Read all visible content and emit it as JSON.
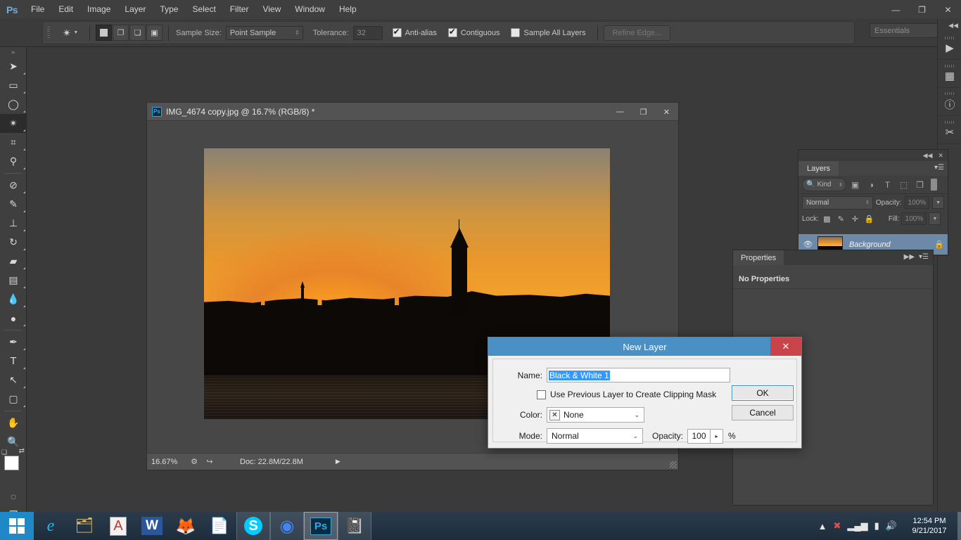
{
  "app": {
    "name": "Adobe Photoshop",
    "logo": "Ps",
    "menus": [
      "File",
      "Edit",
      "Image",
      "Layer",
      "Type",
      "Select",
      "Filter",
      "View",
      "Window",
      "Help"
    ],
    "window_buttons": {
      "minimize": "—",
      "restore": "❐",
      "close": "✕"
    }
  },
  "options_bar": {
    "tool_icon": "magic-wand",
    "sample_size_label": "Sample Size:",
    "sample_size_value": "Point Sample",
    "tolerance_label": "Tolerance:",
    "tolerance_value": "32",
    "antialias_label": "Anti-alias",
    "antialias_checked": true,
    "contiguous_label": "Contiguous",
    "contiguous_checked": true,
    "sample_all_layers_label": "Sample All Layers",
    "sample_all_layers_checked": false,
    "refine_edge_label": "Refine Edge...",
    "workspace_value": "Essentials"
  },
  "toolbar": {
    "tools": [
      {
        "name": "move-tool",
        "glyph": "➤",
        "active": false
      },
      {
        "name": "marquee-tool",
        "glyph": "▭",
        "active": false
      },
      {
        "name": "lasso-tool",
        "glyph": "◯",
        "active": false
      },
      {
        "name": "magic-wand-tool",
        "glyph": "✴",
        "active": true
      },
      {
        "name": "crop-tool",
        "glyph": "⌗",
        "active": false
      },
      {
        "name": "eyedropper-tool",
        "glyph": "⚲",
        "active": false
      },
      {
        "name": "healing-brush-tool",
        "glyph": "⊘",
        "active": false
      },
      {
        "name": "brush-tool",
        "glyph": "✎",
        "active": false
      },
      {
        "name": "clone-stamp-tool",
        "glyph": "⊥",
        "active": false
      },
      {
        "name": "history-brush-tool",
        "glyph": "↻",
        "active": false
      },
      {
        "name": "eraser-tool",
        "glyph": "▰",
        "active": false
      },
      {
        "name": "gradient-tool",
        "glyph": "▤",
        "active": false
      },
      {
        "name": "blur-tool",
        "glyph": "💧",
        "active": false
      },
      {
        "name": "dodge-tool",
        "glyph": "●",
        "active": false
      },
      {
        "name": "pen-tool",
        "glyph": "✒",
        "active": false
      },
      {
        "name": "type-tool",
        "glyph": "T",
        "active": false
      },
      {
        "name": "path-selection-tool",
        "glyph": "↖",
        "active": false
      },
      {
        "name": "rectangle-shape-tool",
        "glyph": "▢",
        "active": false
      },
      {
        "name": "hand-tool",
        "glyph": "✋",
        "active": false
      },
      {
        "name": "zoom-tool",
        "glyph": "🔍",
        "active": false
      }
    ],
    "foreground_color": "#ffffff",
    "background_color": "#ffffff",
    "quick_mask_glyph": "◌",
    "screen_mode_glyph": "❐"
  },
  "right_dock": {
    "collapse_glyph": "◀◀",
    "buttons": [
      {
        "name": "actions-panel-icon",
        "glyph": "▶"
      },
      {
        "name": "histogram-panel-icon",
        "glyph": "▦"
      },
      {
        "name": "info-panel-icon",
        "glyph": "ⓘ"
      },
      {
        "name": "tool-presets-panel-icon",
        "glyph": "✂"
      }
    ]
  },
  "document": {
    "title": "IMG_4674 copy.jpg @ 16.7% (RGB/8) *",
    "badge": "Ps",
    "window_buttons": {
      "minimize": "—",
      "restore": "❐",
      "close": "✕"
    },
    "status": {
      "zoom": "16.67%",
      "doc_label": "Doc: 22.8M/22.8M",
      "arrow": "▶"
    },
    "image_description": "Istanbul sunset skyline silhouette with Galata Tower"
  },
  "layers_panel": {
    "tab_label": "Layers",
    "collapse_glyph": "◀◀",
    "close_glyph": "✕",
    "menu_glyph": "▾☰",
    "filter": {
      "search_glyph": "🔍",
      "kind_value": "Kind",
      "icons": [
        {
          "name": "filter-pixel-layers-icon",
          "glyph": "▣"
        },
        {
          "name": "filter-adjustment-layers-icon",
          "glyph": "◑"
        },
        {
          "name": "filter-type-layers-icon",
          "glyph": "T"
        },
        {
          "name": "filter-shape-layers-icon",
          "glyph": "⬚"
        },
        {
          "name": "filter-smart-objects-icon",
          "glyph": "❐"
        }
      ]
    },
    "blend_mode": "Normal",
    "opacity_label": "Opacity:",
    "opacity_value": "100%",
    "lock_label": "Lock:",
    "lock_icons": [
      {
        "name": "lock-transparent-pixels-icon",
        "glyph": "▩"
      },
      {
        "name": "lock-image-pixels-icon",
        "glyph": "✎"
      },
      {
        "name": "lock-position-icon",
        "glyph": "✛"
      },
      {
        "name": "lock-all-icon",
        "glyph": "🔒"
      }
    ],
    "fill_label": "Fill:",
    "fill_value": "100%",
    "layers": [
      {
        "name": "Background",
        "visible_glyph": "👁",
        "locked_glyph": "🔒",
        "selected": true
      }
    ]
  },
  "properties_panel": {
    "tab_label": "Properties",
    "expand_glyph": "▶▶",
    "menu_glyph": "▾☰",
    "empty_message": "No Properties"
  },
  "new_layer_dialog": {
    "title": "New Layer",
    "close_glyph": "✕",
    "name_label": "Name:",
    "name_value": "Black & White 1",
    "name_selected": true,
    "clipping_mask_label": "Use Previous Layer to Create Clipping Mask",
    "clipping_mask_checked": false,
    "color_label": "Color:",
    "color_value": "None",
    "color_none_glyph": "✕",
    "mode_label": "Mode:",
    "mode_value": "Normal",
    "opacity_label": "Opacity:",
    "opacity_value": "100",
    "percent_symbol": "%",
    "ok_label": "OK",
    "cancel_label": "Cancel",
    "accent_color": "#4a90c4",
    "close_color": "#c9444a",
    "selection_color": "#3399ff"
  },
  "taskbar": {
    "start_label": "Start",
    "items": [
      {
        "name": "taskbar-internet-explorer",
        "glyph": "e",
        "running": false
      },
      {
        "name": "taskbar-file-explorer",
        "glyph": "🗂",
        "running": false
      },
      {
        "name": "taskbar-dictionary-app",
        "glyph": "🅰",
        "running": false
      },
      {
        "name": "taskbar-word",
        "glyph": "W",
        "running": false
      },
      {
        "name": "taskbar-firefox",
        "glyph": "🦊",
        "running": false
      },
      {
        "name": "taskbar-document",
        "glyph": "📄",
        "running": false
      },
      {
        "name": "taskbar-skype",
        "glyph": "S",
        "running": true
      },
      {
        "name": "taskbar-chrome",
        "glyph": "◎",
        "running": true
      },
      {
        "name": "taskbar-photoshop",
        "glyph": "Ps",
        "running": true,
        "active": true
      },
      {
        "name": "taskbar-notepad",
        "glyph": "📓",
        "running": true
      }
    ],
    "tray": [
      {
        "name": "tray-show-hidden-icons",
        "glyph": "▲"
      },
      {
        "name": "tray-antivirus-icon",
        "glyph": "✖"
      },
      {
        "name": "tray-network-icon",
        "glyph": "▂▄▆"
      },
      {
        "name": "tray-battery-icon",
        "glyph": "▮"
      },
      {
        "name": "tray-volume-icon",
        "glyph": "🔊"
      }
    ],
    "clock_time": "12:54 PM",
    "clock_date": "9/21/2017"
  }
}
